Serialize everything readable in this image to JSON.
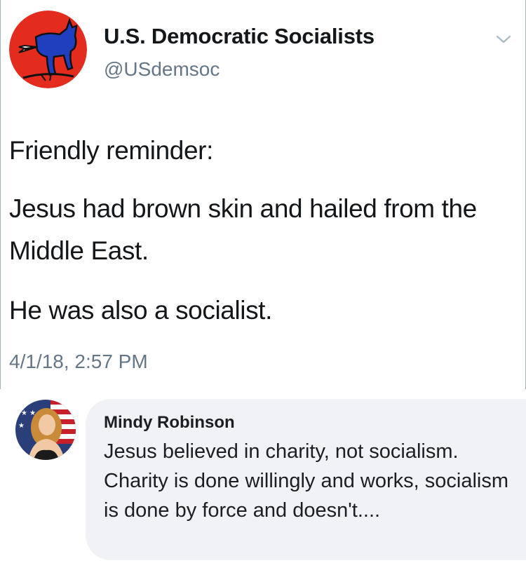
{
  "tweet": {
    "author_name": "U.S. Democratic Socialists",
    "author_handle": "@USdemsoc",
    "text_lines": [
      "Friendly reminder:",
      "Jesus had brown skin and hailed from the Middle East.",
      "He was also a socialist."
    ],
    "timestamp": "4/1/18, 2:57 PM",
    "menu_icon": "chevron-down-icon",
    "colors": {
      "name": "#14171a",
      "secondary": "#657786",
      "logo_red": "#e32b1e",
      "logo_blue": "#1f3fbf"
    }
  },
  "comment": {
    "author_name": "Mindy Robinson",
    "text": "Jesus believed in charity, not socialism. Charity is done willingly and works, socialism is done by force and doesn't....",
    "colors": {
      "bubble": "#f0f2f5",
      "text": "#1c1e21"
    }
  }
}
